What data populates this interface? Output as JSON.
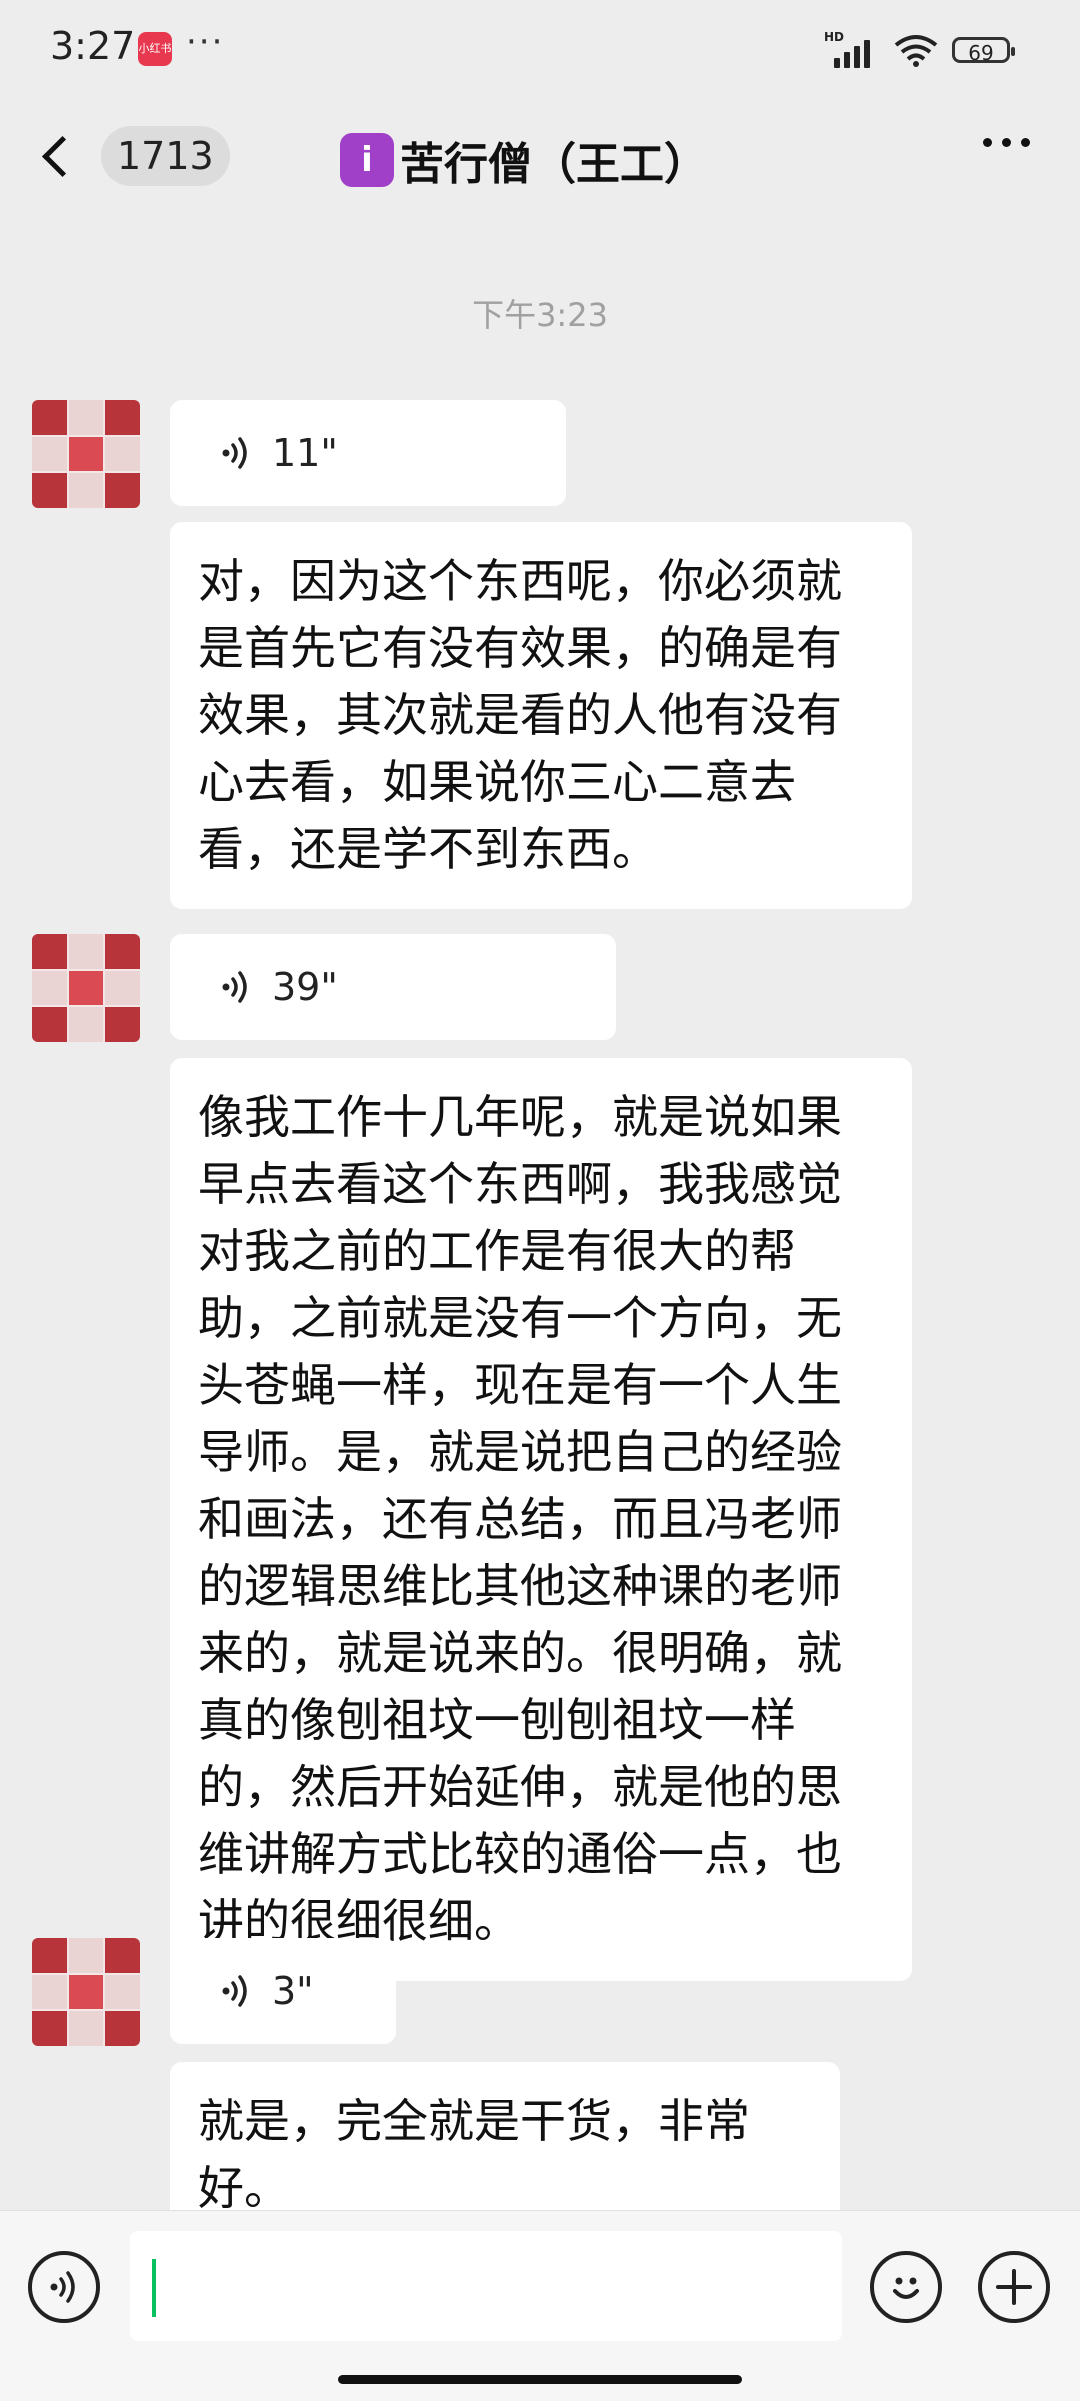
{
  "status_bar": {
    "time": "3:27",
    "app_badge": "小红书",
    "more": "···",
    "network": "HD",
    "battery": "69"
  },
  "header": {
    "unread_count": "1713",
    "title_emoji": "i",
    "title": "苦行僧（王工）"
  },
  "chat": {
    "timestamp": "下午3:23",
    "messages": [
      {
        "voice_duration": "11\"",
        "transcript": "对，因为这个东西呢，你必须就是首先它有没有效果，的确是有效果，其次就是看的人他有没有心去看，如果说你三心二意去看，还是学不到东西。"
      },
      {
        "voice_duration": "39\"",
        "transcript": "像我工作十几年呢，就是说如果早点去看这个东西啊，我我感觉对我之前的工作是有很大的帮助，之前就是没有一个方向，无头苍蝇一样，现在是有一个人生导师。是，就是说把自己的经验和画法，还有总结，而且冯老师的逻辑思维比其他这种课的老师来的，就是说来的。很明确，就真的像刨祖坟一刨刨祖坟一样的，然后开始延伸，就是他的思维讲解方式比较的通俗一点，也讲的很细很细。"
      },
      {
        "voice_duration": "3\"",
        "transcript": "就是，完全就是干货，非常好。"
      }
    ]
  },
  "input_bar": {
    "value": "",
    "placeholder": ""
  },
  "colors": {
    "background": "#ededed",
    "bubble": "#ffffff",
    "cursor": "#07c160"
  }
}
